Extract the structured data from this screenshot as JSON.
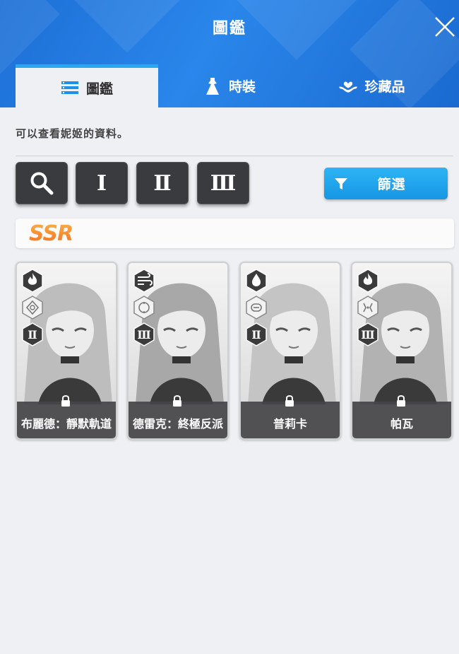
{
  "window": {
    "title": "圖鑑"
  },
  "tabs": [
    {
      "label": "圖鑑",
      "icon": "list-icon",
      "active": true
    },
    {
      "label": "時裝",
      "icon": "dress-icon",
      "active": false
    },
    {
      "label": "珍藏品",
      "icon": "heart-hand-icon",
      "active": false
    }
  ],
  "description": "可以查看妮姬的資料。",
  "toolbar": {
    "search_icon": "search-icon",
    "burst_buttons": [
      "Ⅰ",
      "Ⅱ",
      "Ⅲ"
    ],
    "filter_label": "篩選",
    "filter_icon": "funnel-icon"
  },
  "rarity_section": {
    "label": "SSR",
    "color_top": "#ffb04a",
    "color_bottom": "#f07020"
  },
  "cards": [
    {
      "name": "布麗德：靜默軌道",
      "element_icon": "fire-icon",
      "weapon_icon": "crosshair-icon",
      "burst": "Ⅱ",
      "locked": true
    },
    {
      "name": "德雷克：終極反派",
      "element_icon": "wind-icon",
      "weapon_icon": "scope-icon",
      "burst": "Ⅲ",
      "locked": true
    },
    {
      "name": "普莉卡",
      "element_icon": "water-icon",
      "weapon_icon": "minigun-icon",
      "burst": "Ⅱ",
      "locked": true
    },
    {
      "name": "帕瓦",
      "element_icon": "fire-icon",
      "weapon_icon": "sniper-icon",
      "burst": "Ⅲ",
      "locked": true
    }
  ],
  "colors": {
    "header": "#1d6fd6",
    "accent": "#29a8f0",
    "button_dark": "#3a3b3e"
  }
}
